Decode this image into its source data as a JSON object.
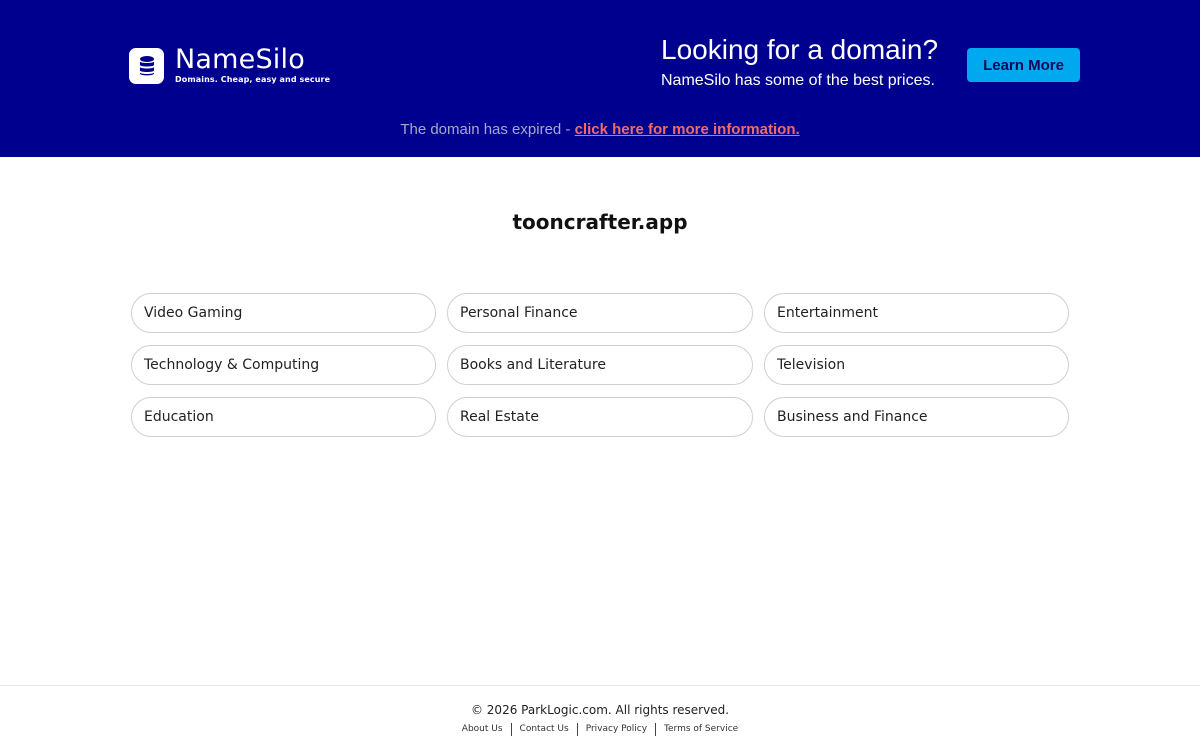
{
  "banner": {
    "logo": {
      "icon": "database-icon",
      "name": "NameSilo",
      "tagline": "Domains. Cheap, easy and secure"
    },
    "promo": {
      "title": "Looking for a domain?",
      "subtitle": "NameSilo has some of the best prices."
    },
    "learn_more_label": "Learn More",
    "expired_text": "The domain has expired - ",
    "expired_link": "click here for more information.",
    "colors": {
      "background": "#00008f",
      "button": "#00a8f0",
      "link": "#f26b6b"
    }
  },
  "main": {
    "domain": "tooncrafter.app",
    "categories": [
      {
        "label": "Video Gaming"
      },
      {
        "label": "Personal Finance"
      },
      {
        "label": "Entertainment"
      },
      {
        "label": "Technology & Computing"
      },
      {
        "label": "Books and Literature"
      },
      {
        "label": "Television"
      },
      {
        "label": "Education"
      },
      {
        "label": "Real Estate"
      },
      {
        "label": "Business and Finance"
      }
    ]
  },
  "footer": {
    "copyright": "© 2026 ParkLogic.com. All rights reserved.",
    "links": [
      {
        "label": "About Us"
      },
      {
        "label": "Contact Us"
      },
      {
        "label": "Privacy Policy"
      },
      {
        "label": "Terms of Service"
      }
    ]
  }
}
